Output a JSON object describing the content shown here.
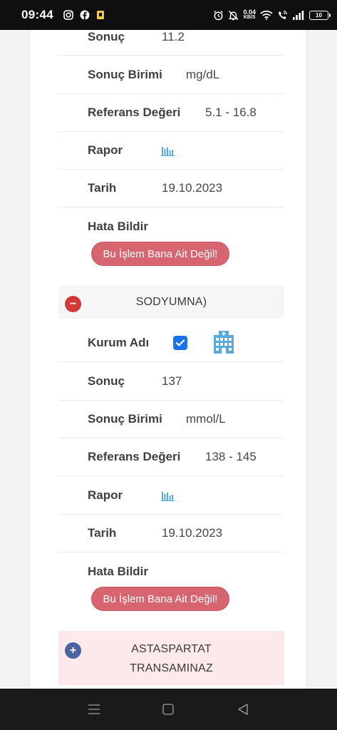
{
  "status_bar": {
    "time": "09:44",
    "left_icons": [
      "instagram-icon",
      "facebook-icon",
      "app-notification-icon"
    ],
    "right_icons": [
      "alarm-icon",
      "mute-icon",
      "wifi-icon",
      "wifi-calling-icon",
      "signal-icon"
    ],
    "speed_value": "0.04",
    "speed_unit": "KB/S",
    "battery": "10"
  },
  "record1": {
    "sonuc_label": "Sonuç",
    "sonuc_value": "11.2",
    "birim_label": "Sonuç Birimi",
    "birim_value": "mg/dL",
    "referans_label": "Referans Değeri",
    "referans_value": "5.1 - 16.8",
    "rapor_label": "Rapor",
    "tarih_label": "Tarih",
    "tarih_value": "19.10.2023",
    "hata_label": "Hata Bildir",
    "hata_button": "Bu İşlem Bana Ait Değil!"
  },
  "section_sodyum": {
    "toggle": "−",
    "title": "SODYUMNA)",
    "kurum_label": "Kurum Adı",
    "kurum_checked": true,
    "sonuc_label": "Sonuç",
    "sonuc_value": "137",
    "birim_label": "Sonuç Birimi",
    "birim_value": "mmol/L",
    "referans_label": "Referans Değeri",
    "referans_value": "138 - 145",
    "rapor_label": "Rapor",
    "tarih_label": "Tarih",
    "tarih_value": "19.10.2023",
    "hata_label": "Hata Bildir",
    "hata_button": "Bu İşlem Bana Ait Değil!"
  },
  "section_ast": {
    "toggle": "+",
    "title_line1": "ASTASPARTAT",
    "title_line2": "TRANSAMINAZ"
  },
  "colors": {
    "accent_red": "#d66570",
    "minus_circle": "#d23a3a",
    "plus_circle": "#4a63a3",
    "checkbox_blue": "#1a73e8",
    "report_icon": "#5aa9dc",
    "ast_header_bg": "#fde8ea"
  }
}
